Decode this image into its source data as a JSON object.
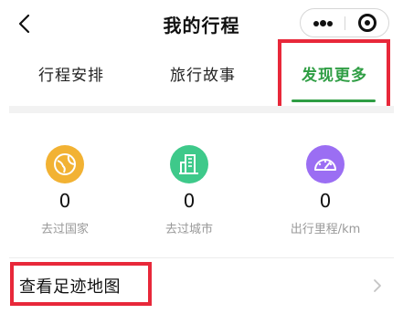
{
  "nav": {
    "title": "我的行程"
  },
  "tabs": [
    {
      "label": "行程安排",
      "active": false
    },
    {
      "label": "旅行故事",
      "active": false
    },
    {
      "label": "发现更多",
      "active": true
    }
  ],
  "stats": [
    {
      "value": "0",
      "label": "去过国家",
      "icon": "globe-icon",
      "color": "#f2b233"
    },
    {
      "value": "0",
      "label": "去过城市",
      "icon": "building-icon",
      "color": "#3ec98a"
    },
    {
      "value": "0",
      "label": "出行里程/km",
      "icon": "speedometer-icon",
      "color": "#9b6ef3"
    }
  ],
  "footprint": {
    "label": "查看足迹地图"
  },
  "colors": {
    "accent": "#2f9e44",
    "highlight": "#e8283a"
  }
}
